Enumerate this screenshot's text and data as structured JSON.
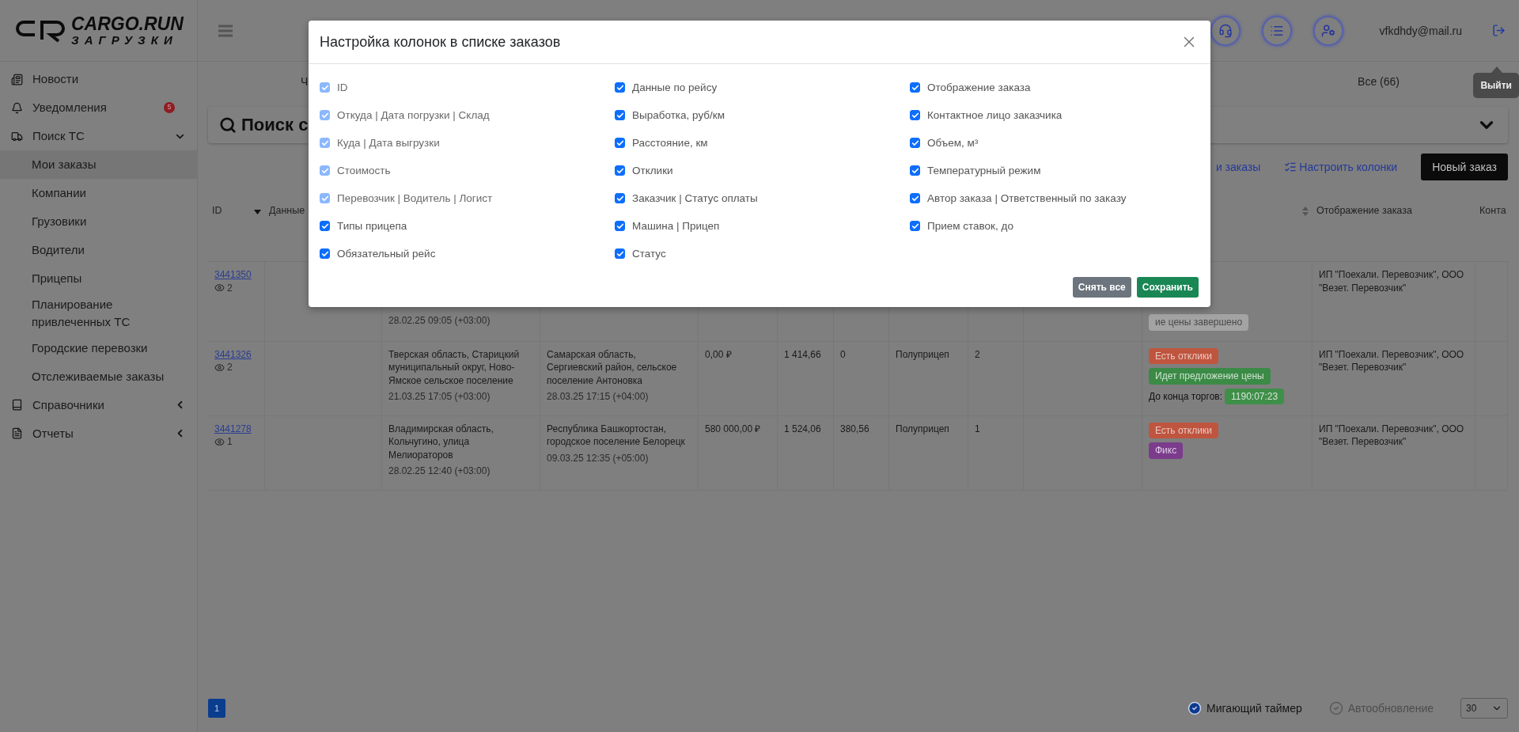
{
  "sidebar": {
    "logo": {
      "title": "CARGO.RUN",
      "subtitle": "ЗАГРУЗКИ"
    },
    "items": [
      {
        "label": "Новости"
      },
      {
        "label": "Уведомления",
        "badge": "5"
      },
      {
        "label": "Поиск ТС",
        "expanded": true,
        "children": [
          {
            "label": "Мои заказы",
            "selected": true
          },
          {
            "label": "Компании",
            "selected": false
          },
          {
            "label": "Грузовики",
            "selected": false
          },
          {
            "label": "Водители",
            "selected": false
          },
          {
            "label": "Прицепы",
            "selected": false
          },
          {
            "label": "Планирование привлеченных ТС",
            "selected": false
          },
          {
            "label": "Городские перевозки",
            "selected": false
          },
          {
            "label": "Отслеживаемые заказы",
            "selected": false
          }
        ]
      },
      {
        "label": "Справочники",
        "expanded": false
      },
      {
        "label": "Отчеты",
        "expanded": false
      }
    ]
  },
  "header": {
    "user_email": "vfkdhdy@mail.ru",
    "tooltip": "Выйти"
  },
  "tabs": [
    {
      "label": "Ч"
    },
    {
      "label": "Все (66)"
    }
  ],
  "search": {
    "title": "Поиск с"
  },
  "actions": {
    "orders_link": "и заказы",
    "columns_link": "Настроить колонки",
    "new_order": "Новый заказ"
  },
  "table": {
    "columns": [
      {
        "label": "ID",
        "sorted": true
      },
      {
        "label": "Данные"
      },
      {},
      {},
      {},
      {},
      {},
      {},
      {},
      {},
      {
        "sortable": true
      },
      {
        "label": "Отображение заказа"
      },
      {
        "label": "Конта"
      }
    ],
    "rows": [
      {
        "id": "3441350",
        "views": "2",
        "origin": {
          "time": "28.02.25 09:05 (+03:00)"
        },
        "statuses": [
          {
            "text": "ие цены завершено",
            "kind": "closed"
          }
        ],
        "display": "ИП \"Поехали. Перевозчик\", ООО \"Везет. Перевозчик\""
      },
      {
        "id": "3441326",
        "views": "2",
        "origin": {
          "address": "Тверская область, Старицкий муниципальный округ, Ново-Ямское сельское поселение",
          "time": "21.03.25 17:05 (+03:00)"
        },
        "destination": {
          "address": "Самарская область, Сергиевский район, сельское поселение Антоновка",
          "time": "28.03.25 17:15 (+04:00)"
        },
        "price": "0,00 ₽",
        "rate": "1 414,66",
        "distance": "0",
        "trailer": "Полуприцеп",
        "responses": "2",
        "statuses": [
          {
            "text": "Есть отклики",
            "kind": "responses"
          },
          {
            "text": "Идет предложение цены",
            "kind": "bidding"
          }
        ],
        "timer": {
          "label": "До конца торгов:",
          "value": "1190:07:23"
        },
        "display": "ИП \"Поехали. Перевозчик\", ООО \"Везет. Перевозчик\""
      },
      {
        "id": "3441278",
        "views": "1",
        "origin": {
          "address": "Владимирская область, Кольчугино, улица Мелиораторов",
          "time": "28.02.25 12:40 (+03:00)"
        },
        "destination": {
          "address": "Республика Башкортостан, городское поселение Белорецк",
          "time": "09.03.25 12:35 (+05:00)"
        },
        "price": "580 000,00 ₽",
        "rate": "1 524,06",
        "distance": "380,56",
        "trailer": "Полуприцеп",
        "responses": "1",
        "statuses": [
          {
            "text": "Есть отклики",
            "kind": "responses"
          },
          {
            "text": "Фикс",
            "kind": "fixed"
          }
        ],
        "display": "ИП \"Поехали. Перевозчик\", ООО \"Везет. Перевозчик\""
      }
    ]
  },
  "footer": {
    "pages": [
      {
        "label": "1",
        "selected": true
      }
    ],
    "toggles": [
      {
        "label": "Мигающий таймер",
        "checked": true
      },
      {
        "label": "Автообновление",
        "checked": false
      }
    ],
    "page_size": "30"
  },
  "modal": {
    "title": "Настройка колонок в списке заказов",
    "columns": [
      [
        {
          "label": "ID",
          "checked": true,
          "disabled": true
        },
        {
          "label": "Откуда | Дата погрузки | Склад",
          "checked": true,
          "disabled": true
        },
        {
          "label": "Куда | Дата выгрузки",
          "checked": true,
          "disabled": true
        },
        {
          "label": "Стоимость",
          "checked": true,
          "disabled": true
        },
        {
          "label": "Перевозчик | Водитель | Логист",
          "checked": true,
          "disabled": true
        },
        {
          "label": "Типы прицепа",
          "checked": true,
          "disabled": false
        },
        {
          "label": "Обязательный рейс",
          "checked": true,
          "disabled": false
        }
      ],
      [
        {
          "label": "Данные по рейсу",
          "checked": true,
          "disabled": false
        },
        {
          "label": "Выработка, руб/км",
          "checked": true,
          "disabled": false
        },
        {
          "label": "Расстояние, км",
          "checked": true,
          "disabled": false
        },
        {
          "label": "Отклики",
          "checked": true,
          "disabled": false
        },
        {
          "label": "Заказчик | Статус оплаты",
          "checked": true,
          "disabled": false
        },
        {
          "label": "Машина | Прицеп",
          "checked": true,
          "disabled": false
        },
        {
          "label": "Статус",
          "checked": true,
          "disabled": false
        }
      ],
      [
        {
          "label": "Отображение заказа",
          "checked": true,
          "disabled": false
        },
        {
          "label": "Контактное лицо заказчика",
          "checked": true,
          "disabled": false
        },
        {
          "label": "Объем, м³",
          "checked": true,
          "disabled": false
        },
        {
          "label": "Температурный режим",
          "checked": true,
          "disabled": false
        },
        {
          "label": "Автор заказа | Ответственный по заказу",
          "checked": true,
          "disabled": false
        },
        {
          "label": "Прием ставок, до",
          "checked": true,
          "disabled": false
        }
      ]
    ],
    "buttons": {
      "clear": "Снять все",
      "save": "Сохранить"
    }
  }
}
